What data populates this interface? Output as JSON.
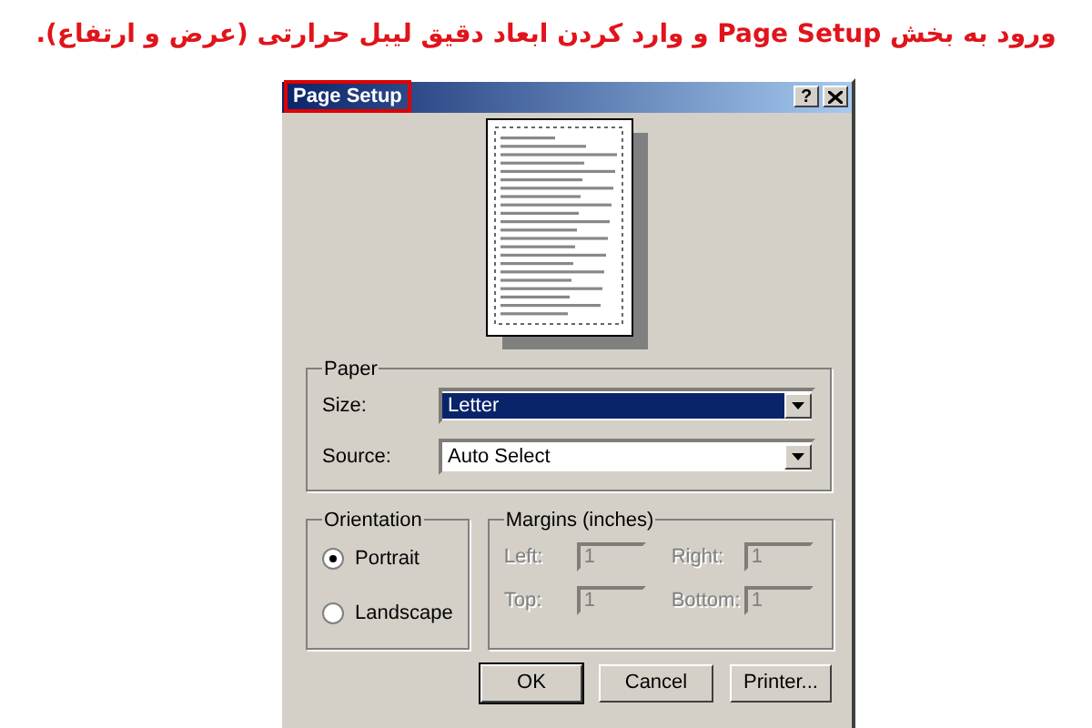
{
  "caption": "ورود به بخش Page Setup و وارد کردن ابعاد دقیق لیبل حرارتی (عرض و ارتفاع).",
  "dialog": {
    "title": "Page Setup",
    "title_highlighted": true,
    "help": "?",
    "paper": {
      "legend": "Paper",
      "fields": [
        {
          "label": "Size:",
          "value": "Letter",
          "selected": true
        },
        {
          "label": "Source:",
          "value": "Auto Select",
          "selected": false
        }
      ]
    },
    "orientation": {
      "legend": "Orientation",
      "options": [
        {
          "label": "Portrait",
          "selected": true
        },
        {
          "label": "Landscape",
          "selected": false
        }
      ]
    },
    "margins": {
      "legend": "Margins (inches)",
      "disabled": true,
      "fields": [
        {
          "label": "Left:",
          "value": "1"
        },
        {
          "label": "Right:",
          "value": "1"
        },
        {
          "label": "Top:",
          "value": "1"
        },
        {
          "label": "Bottom:",
          "value": "1"
        }
      ]
    },
    "buttons": [
      {
        "label": "OK",
        "default": true
      },
      {
        "label": "Cancel",
        "default": false
      },
      {
        "label": "Printer...",
        "default": false
      }
    ]
  }
}
